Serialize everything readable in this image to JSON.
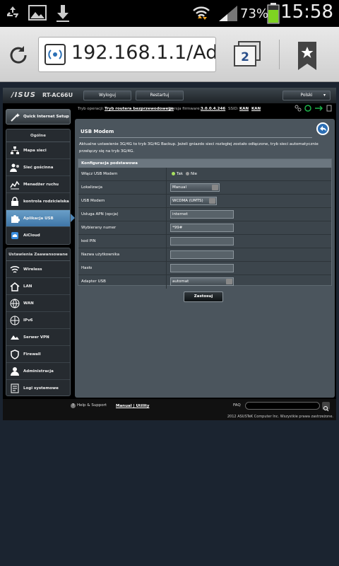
{
  "statusbar": {
    "battery": "73%",
    "time": "15:58"
  },
  "browser": {
    "url": "192.168.1.1/Adv",
    "tab_count": "2"
  },
  "router": {
    "logo": "/ISUS",
    "model": "RT-AC66U",
    "logout": "Wyloguj",
    "restart": "Restartuj",
    "language": "Polski",
    "op_mode_label": "Tryb operacji:",
    "op_mode_value": "Tryb routera bezprzewodowego",
    "fw_label": "Wersja firmware:",
    "fw_value": "3.0.0.4.246",
    "ssid_label": "SSID:",
    "ssid1": "KAN",
    "ssid2": "KAN"
  },
  "sidebar": {
    "quick_setup": "Quick Internet Setup",
    "general_head": "Ogólne",
    "general_items": [
      {
        "label": "Mapa sieci"
      },
      {
        "label": "Sieć gościnna"
      },
      {
        "label": "Menadżer ruchu"
      },
      {
        "label": "kontrola rodzicielska"
      },
      {
        "label": "Aplikacja USB"
      },
      {
        "label": "AiCloud"
      }
    ],
    "advanced_head": "Ustawienia Zaawansowane",
    "advanced_items": [
      {
        "label": "Wireless"
      },
      {
        "label": "LAN"
      },
      {
        "label": "WAN"
      },
      {
        "label": "IPv6"
      },
      {
        "label": "Serwer VPN"
      },
      {
        "label": "Firewall"
      },
      {
        "label": "Administracja"
      },
      {
        "label": "Logi systemowe"
      }
    ]
  },
  "main": {
    "title": "USB Modem",
    "description": "Aktualne ustawienie 3G/4G to tryb 3G/4G Backup. Jeżeli gniazdo sieci rozległej zostało odłączone, tryb sieci automatycznie przełączy się na tryb 3G/4G.",
    "config_head": "Konfiguracja podstawowa",
    "rows": {
      "enable_label": "Włącz USB Modem",
      "yes": "Tak",
      "no": "Nie",
      "location_label": "Lokalizacja",
      "location_value": "Manual",
      "modem_label": "USB Modem",
      "modem_value": "WCDMA (UMTS)",
      "apn_label": "Usługa APN (opcja)",
      "apn_value": "internet",
      "dial_label": "Wybierany numer",
      "dial_value": "*99#",
      "pin_label": "kod PIN",
      "pin_value": "",
      "user_label": "Nazwa użytkownika",
      "user_value": "",
      "pass_label": "Hasło",
      "pass_value": "",
      "adapter_label": "Adapter USB",
      "adapter_value": "automat"
    },
    "apply": "Zastosuj"
  },
  "footer": {
    "help": "Help & Support",
    "manual": "Manual",
    "sep": " | ",
    "utility": "Utility",
    "faq": "FAQ",
    "copyright": "2012 ASUSTeK Computer Inc. Wszystkie prawa zastrzeżone."
  }
}
